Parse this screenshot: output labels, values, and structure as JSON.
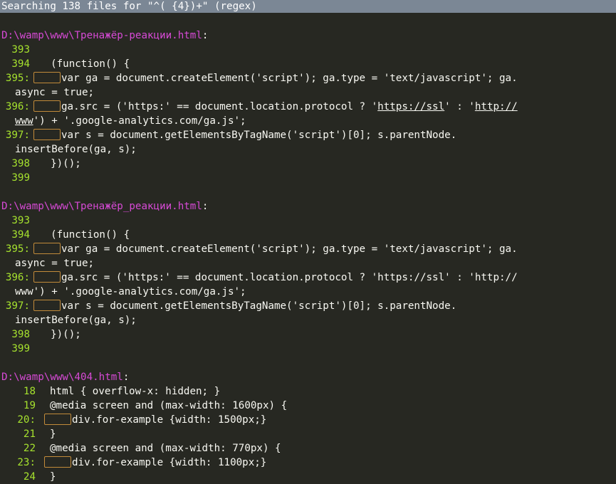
{
  "header": {
    "title": "Searching 138 files for \"^( {4})+\" (regex)"
  },
  "files": [
    {
      "path": "D:\\wamp\\www\\Тренажёр-реакции.html",
      "lines": [
        {
          "num": "393",
          "code": ""
        },
        {
          "num": "394",
          "code": "  (function() {"
        },
        {
          "num": "395:",
          "code": "var ga = document.createElement('script'); ga.type = 'text/javascript'; ga.",
          "cont": "async = true;"
        },
        {
          "num": "396:",
          "code_pre": "ga.src = ('https:' == document.location.protocol ? '",
          "code_u1": "https://ssl",
          "code_mid": "' : '",
          "code_u2": "http://",
          "cont_u": "www",
          "cont": "') + '.google-analytics.com/ga.js';"
        },
        {
          "num": "397:",
          "code": "var s = document.getElementsByTagName('script')[0]; s.parentNode.",
          "cont": "insertBefore(ga, s);"
        },
        {
          "num": "398",
          "code": "  })();"
        },
        {
          "num": "399",
          "code": ""
        }
      ]
    },
    {
      "path": "D:\\wamp\\www\\Тренажёр_реакции.html",
      "lines": [
        {
          "num": "393",
          "code": ""
        },
        {
          "num": "394",
          "code": "  (function() {"
        },
        {
          "num": "395:",
          "code": "var ga = document.createElement('script'); ga.type = 'text/javascript'; ga.",
          "cont": "async = true;"
        },
        {
          "num": "396:",
          "code": "ga.src = ('https:' == document.location.protocol ? 'https://ssl' : 'http://",
          "cont": "www') + '.google-analytics.com/ga.js';"
        },
        {
          "num": "397:",
          "code": "var s = document.getElementsByTagName('script')[0]; s.parentNode.",
          "cont": "insertBefore(ga, s);"
        },
        {
          "num": "398",
          "code": "  })();"
        },
        {
          "num": "399",
          "code": ""
        }
      ]
    },
    {
      "path": "D:\\wamp\\www\\404.html",
      "lines": [
        {
          "num": "18",
          "code": "html { overflow-x: hidden; }"
        },
        {
          "num": "19",
          "code": "@media screen and (max-width: 1600px) {"
        },
        {
          "num": "20:",
          "code": "div.for-example {width: 1500px;}"
        },
        {
          "num": "21",
          "code": "}"
        },
        {
          "num": "22",
          "code": "@media screen and (max-width: 770px) {"
        },
        {
          "num": "23:",
          "code": "div.for-example {width: 1100px;}"
        },
        {
          "num": "24",
          "code": "}"
        }
      ]
    }
  ]
}
